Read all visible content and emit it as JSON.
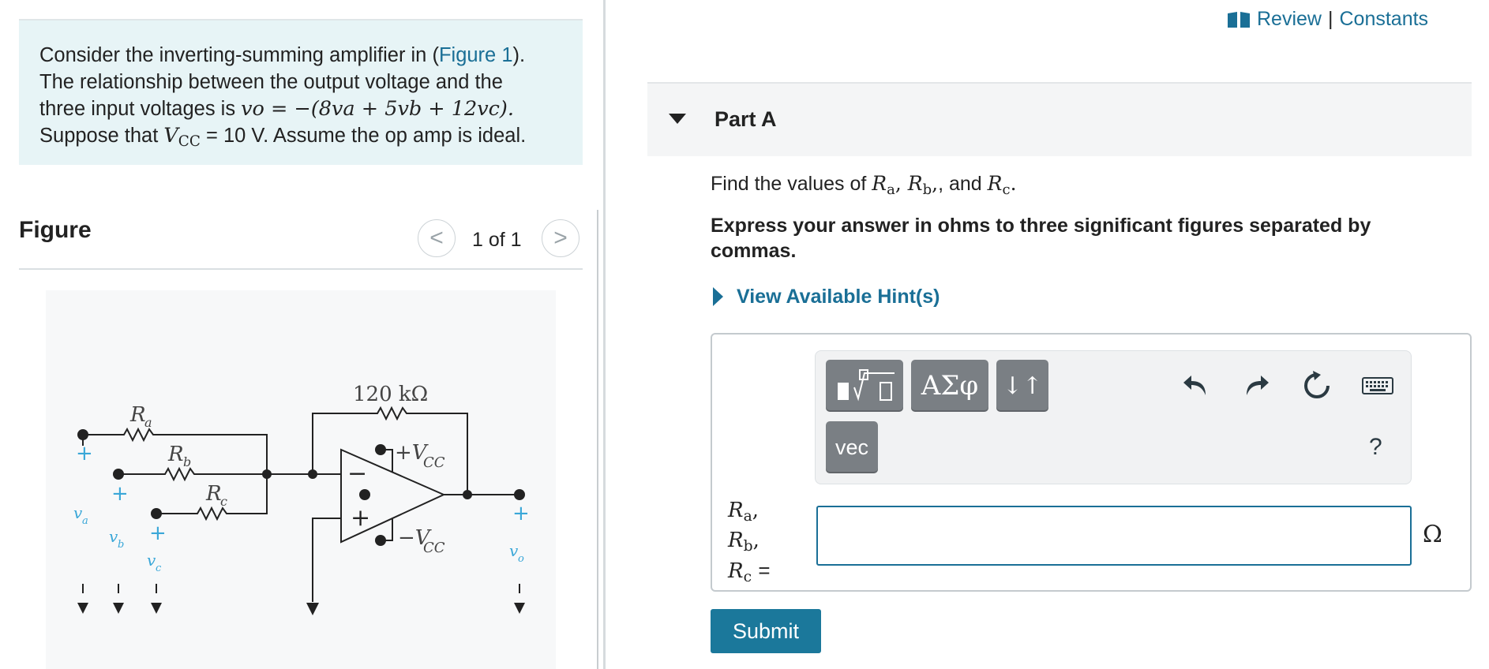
{
  "header": {
    "review_label": "Review",
    "separator": "|",
    "constants_label": "Constants"
  },
  "problem": {
    "intro_before_link": "Consider the inverting-summing amplifier in (",
    "figure_link": "Figure 1",
    "intro_after_link": ").",
    "line2": "The relationship between the output voltage and the",
    "line3_prefix": "three input voltages is ",
    "equation": "vo = −(8va + 5vb + 12vc).",
    "line4_prefix": "Suppose that ",
    "vcc_value": "= 10 V",
    "line4_suffix": ". Assume the op amp is ideal."
  },
  "figure": {
    "title": "Figure",
    "pager": "1 of 1",
    "prev_symbol": "<",
    "next_symbol": ">",
    "labels": {
      "feedback_resistor": "120 kΩ",
      "ra": "R",
      "ra_sub": "a",
      "rb": "R",
      "rb_sub": "b",
      "rc": "R",
      "rc_sub": "c",
      "vcc_pos": "+V",
      "vcc_neg": "−V",
      "vcc_sub": "CC",
      "va": "v",
      "va_sub": "a",
      "vb": "v",
      "vb_sub": "b",
      "vc": "v",
      "vc_sub": "c",
      "vo": "v",
      "vo_sub": "o",
      "plus": "+",
      "minus": "−"
    }
  },
  "part_a": {
    "title": "Part A",
    "question_prefix": "Find the values of ",
    "question_and": ", and ",
    "instruction": "Express your answer in ohms to three significant figures separated by commas.",
    "hint_label": "View Available Hint(s)",
    "toolbar": {
      "greek_label": "ΑΣφ",
      "sort_label": "↓↑",
      "vec_label": "vec",
      "help_label": "?"
    },
    "answer_value": "",
    "unit": "Ω",
    "submit_label": "Submit"
  },
  "colors": {
    "accent": "#1a6f96",
    "submit": "#1b789b",
    "problem_bg": "#e7f4f6",
    "figure_blue": "#3aa7d8"
  }
}
